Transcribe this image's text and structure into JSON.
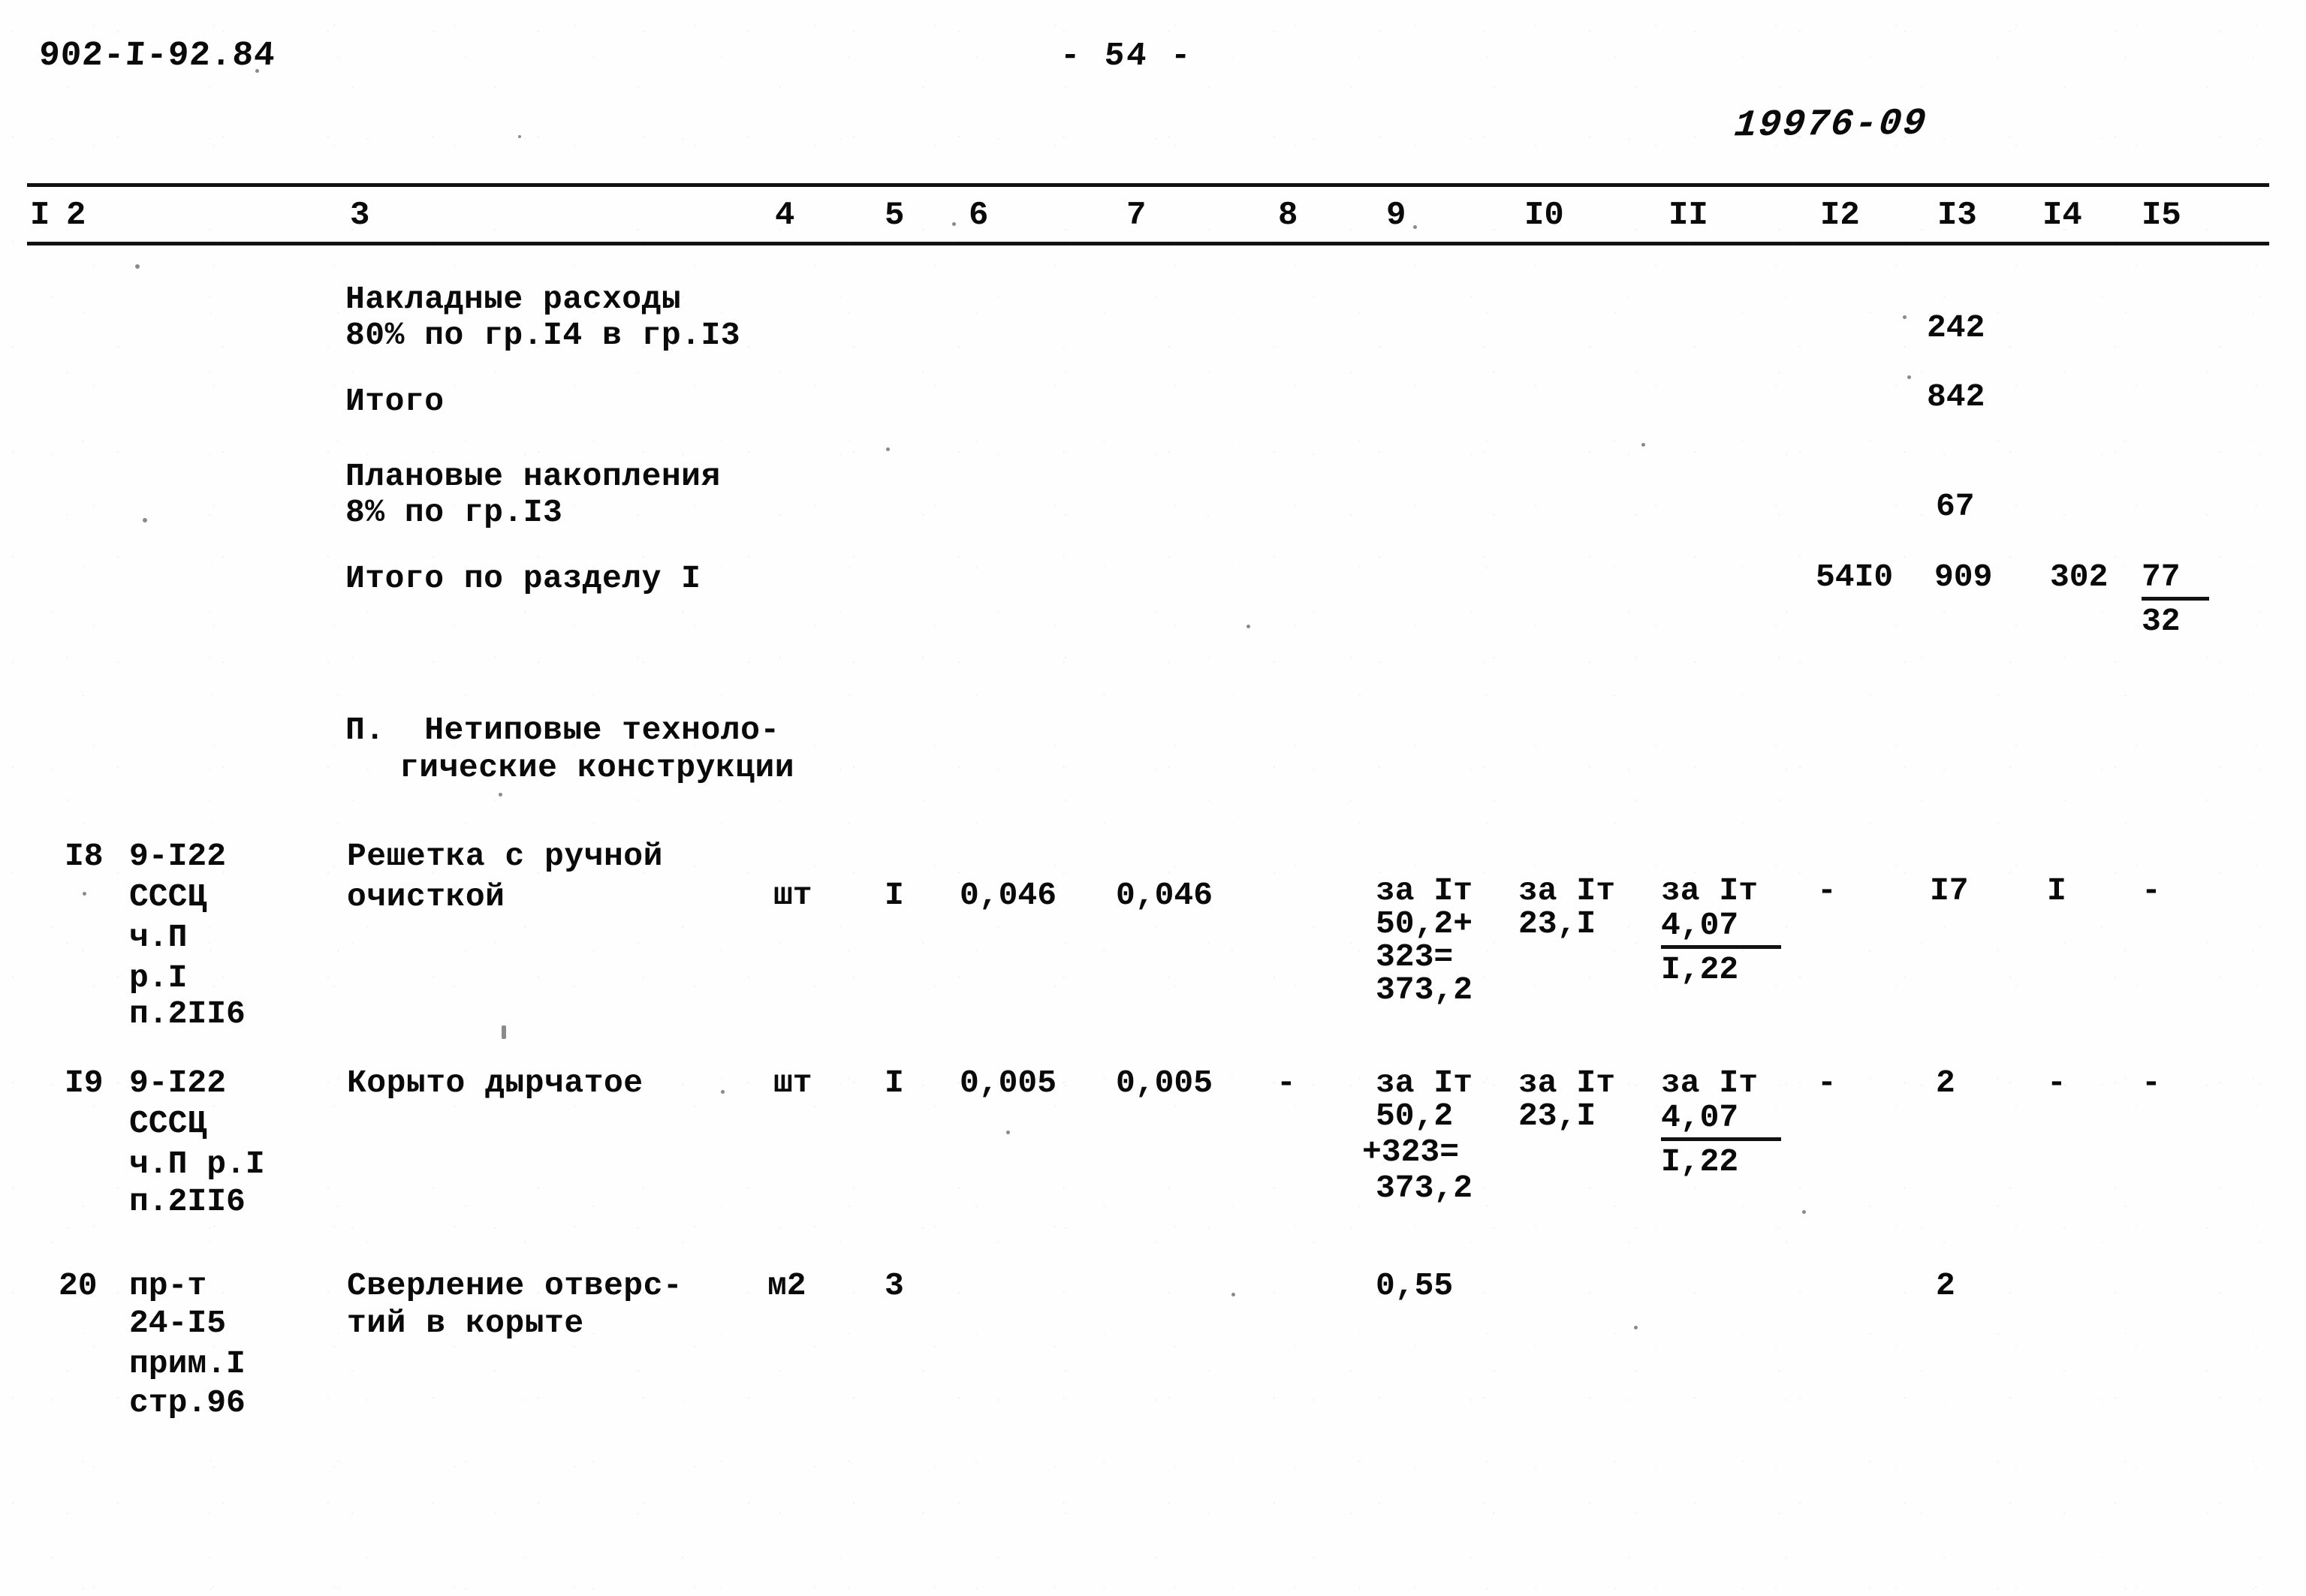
{
  "header": {
    "document_code": "902-I-92.84",
    "page_marker": "- 54 -",
    "archive_stamp": "19976-09"
  },
  "table": {
    "column_headers": [
      "I",
      "2",
      "3",
      "4",
      "5",
      "6",
      "7",
      "8",
      "9",
      "I0",
      "II",
      "I2",
      "I3",
      "I4",
      "I5"
    ],
    "summary_rows": [
      {
        "name": "overhead-costs",
        "description_line1": "Накладные расходы",
        "description_line2": "80% по гр.I4 в гр.I3",
        "col13": "242"
      },
      {
        "name": "subtotal",
        "description_line1": "Итого",
        "description_line2": "",
        "col13": "842"
      },
      {
        "name": "planned-savings",
        "description_line1": "Плановые накопления",
        "description_line2": "8% по гр.I3",
        "col13": "67"
      },
      {
        "name": "section-total",
        "description_line1": "Итого по разделу I",
        "description_line2": "",
        "col12": "54I0",
        "col13": "909",
        "col14": "302",
        "col15_numerator": "77",
        "col15_denominator": "32"
      }
    ],
    "section_heading": {
      "line1": "П.  Нетиповые техноло-",
      "line2": "гические конструкции"
    },
    "item_rows": [
      {
        "no": "I8",
        "code_lines": [
          "9-I22",
          "СССЦ",
          "ч.П",
          "р.I",
          "п.2II6"
        ],
        "description_lines": [
          "Решетка с ручной",
          "очисткой"
        ],
        "unit": "шт",
        "qty": "I",
        "col6": "0,046",
        "col7": "0,046",
        "col8": "",
        "col9_lines": [
          "за Iт",
          "50,2+",
          "323=",
          "373,2"
        ],
        "col10_lines": [
          "за Iт",
          "23,I"
        ],
        "col11_header": "за Iт",
        "col11_numerator": "4,07",
        "col11_denominator": "I,22",
        "col12": "-",
        "col13": "I7",
        "col14": "I",
        "col15": "-"
      },
      {
        "no": "I9",
        "code_lines": [
          "9-I22",
          "СССЦ",
          "ч.П р.I",
          "п.2II6"
        ],
        "description_lines": [
          "Корыто дырчатое"
        ],
        "unit": "шт",
        "qty": "I",
        "col6": "0,005",
        "col7": "0,005",
        "col8": "-",
        "col9_lines": [
          "за Iт",
          "50,2",
          "+323=",
          "373,2"
        ],
        "col10_lines": [
          "за Iт",
          "23,I"
        ],
        "col11_header": "за Iт",
        "col11_numerator": "4,07",
        "col11_denominator": "I,22",
        "col12": "-",
        "col13": "2",
        "col14": "-",
        "col15": "-"
      },
      {
        "no": "20",
        "code_lines": [
          "пр-т",
          "24-I5",
          "прим.I",
          "стр.96"
        ],
        "description_lines": [
          "Сверление отверс-",
          "тий в корыте"
        ],
        "unit": "м2",
        "qty": "3",
        "col6": "",
        "col7": "",
        "col8": "",
        "col9_lines": [
          "0,55"
        ],
        "col10_lines": [],
        "col11_header": "",
        "col11_numerator": "",
        "col11_denominator": "",
        "col12": "",
        "col13": "2",
        "col14": "",
        "col15": ""
      }
    ]
  }
}
